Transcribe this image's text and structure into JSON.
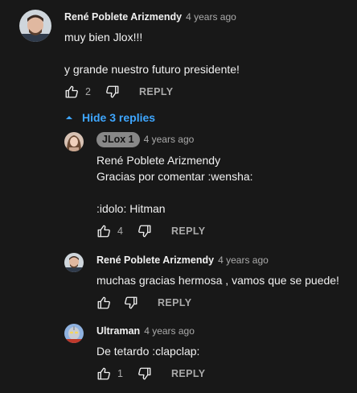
{
  "top_comment": {
    "author": "René Poblete Arizmendy",
    "time": "4 years ago",
    "text": "muy bien Jlox!!!\n\ny grande nuestro futuro presidente!",
    "likes": "2",
    "reply_label": "REPLY"
  },
  "hide_replies_label": "Hide 3 replies",
  "replies": [
    {
      "author": "JLox 1",
      "time": "4 years ago",
      "text": "René Poblete Arizmendy\nGracias por comentar :wensha:\n\n:idolo: Hitman",
      "likes": "4",
      "reply_label": "REPLY"
    },
    {
      "author": "René Poblete Arizmendy",
      "time": "4 years ago",
      "text": "muchas gracias hermosa , vamos que se puede!",
      "likes": "",
      "reply_label": "REPLY"
    },
    {
      "author": "Ultraman",
      "time": "4 years ago",
      "text": "De tetardo :clapclap:",
      "likes": "1",
      "reply_label": "REPLY"
    }
  ],
  "colors": {
    "background": "#181818",
    "text": "#f1f1f1",
    "secondary": "#aaaaaa",
    "link": "#3ea6ff"
  }
}
